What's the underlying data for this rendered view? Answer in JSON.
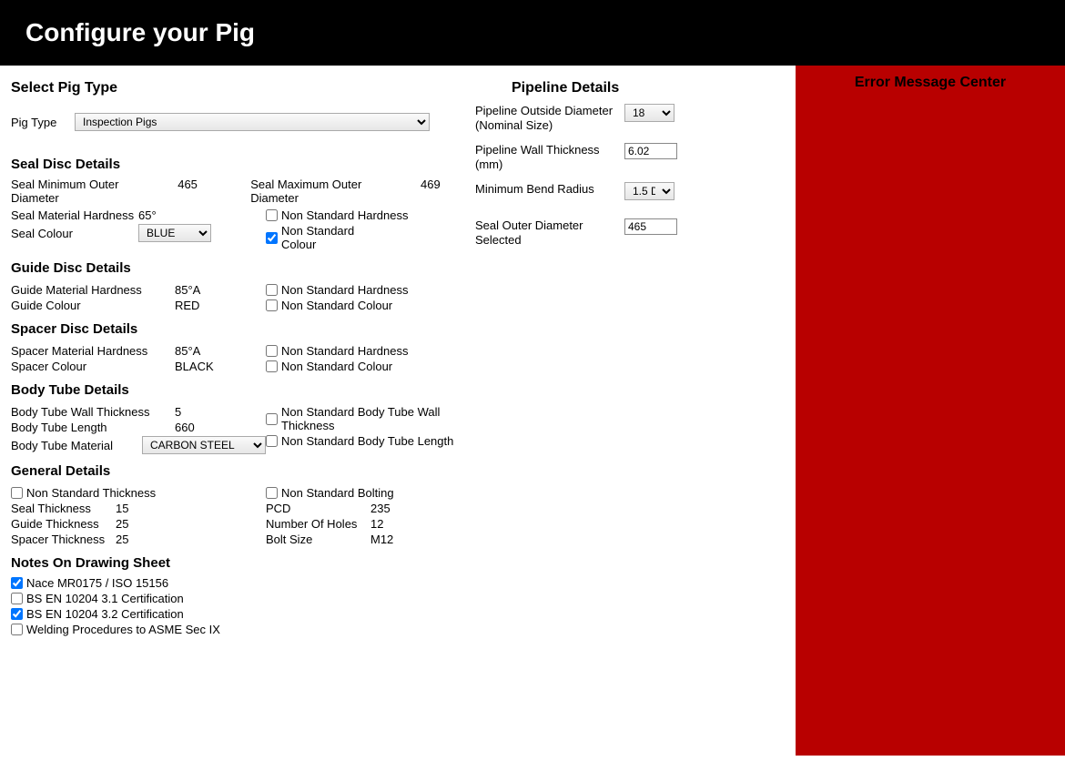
{
  "header": {
    "title": "Configure your Pig"
  },
  "pigType": {
    "sectionTitle": "Select Pig Type",
    "label": "Pig Type",
    "value": "Inspection Pigs"
  },
  "pipeline": {
    "sectionTitle": "Pipeline Details",
    "diameterLabel": "Pipeline Outside Diameter (Nominal Size)",
    "diameterValue": "18",
    "wallLabel": "Pipeline Wall Thickness (mm)",
    "wallValue": "6.02",
    "bendLabel": "Minimum Bend Radius",
    "bendValue": "1.5 D",
    "sealSelectedLabel": "Seal Outer Diameter Selected",
    "sealSelectedValue": "465"
  },
  "sealDisc": {
    "sectionTitle": "Seal Disc Details",
    "minLabel": "Seal Minimum Outer Diameter",
    "minValue": "465",
    "maxLabel": "Seal Maximum Outer Diameter",
    "maxValue": "469",
    "hardnessLabel": "Seal Material Hardness",
    "hardnessValue": "65°",
    "colourLabel": "Seal Colour",
    "colourValue": "BLUE",
    "nsHardness": "Non Standard Hardness",
    "nsColour": "Non Standard Colour"
  },
  "guideDisc": {
    "sectionTitle": "Guide Disc Details",
    "hardnessLabel": "Guide Material Hardness",
    "hardnessValue": "85°A",
    "colourLabel": "Guide Colour",
    "colourValue": "RED",
    "nsHardness": "Non Standard Hardness",
    "nsColour": "Non Standard Colour"
  },
  "spacerDisc": {
    "sectionTitle": "Spacer Disc Details",
    "hardnessLabel": "Spacer Material Hardness",
    "hardnessValue": "85°A",
    "colourLabel": "Spacer Colour",
    "colourValue": "BLACK",
    "nsHardness": "Non Standard Hardness",
    "nsColour": "Non Standard Colour"
  },
  "bodyTube": {
    "sectionTitle": "Body Tube Details",
    "wallLabel": "Body Tube Wall Thickness",
    "wallValue": "5",
    "lengthLabel": "Body Tube Length",
    "lengthValue": "660",
    "materialLabel": "Body Tube Material",
    "materialValue": "CARBON STEEL",
    "nsWall": "Non Standard Body Tube Wall Thickness",
    "nsLength": "Non Standard Body Tube Length"
  },
  "general": {
    "sectionTitle": "General Details",
    "nsThickness": "Non Standard Thickness",
    "nsBolting": "Non Standard Bolting",
    "sealThickLabel": "Seal Thickness",
    "sealThickValue": "15",
    "guideThickLabel": "Guide Thickness",
    "guideThickValue": "25",
    "spacerThickLabel": "Spacer Thickness",
    "spacerThickValue": "25",
    "pcdLabel": "PCD",
    "pcdValue": "235",
    "holesLabel": "Number Of Holes",
    "holesValue": "12",
    "boltLabel": "Bolt Size",
    "boltValue": "M12"
  },
  "notes": {
    "sectionTitle": "Notes On Drawing Sheet",
    "n1": "Nace MR0175 / ISO 15156",
    "n2": "BS EN 10204 3.1 Certification",
    "n3": "BS EN 10204 3.2 Certification",
    "n4": "Welding Procedures to ASME Sec IX"
  },
  "errorPanel": {
    "title": "Error Message Center"
  }
}
